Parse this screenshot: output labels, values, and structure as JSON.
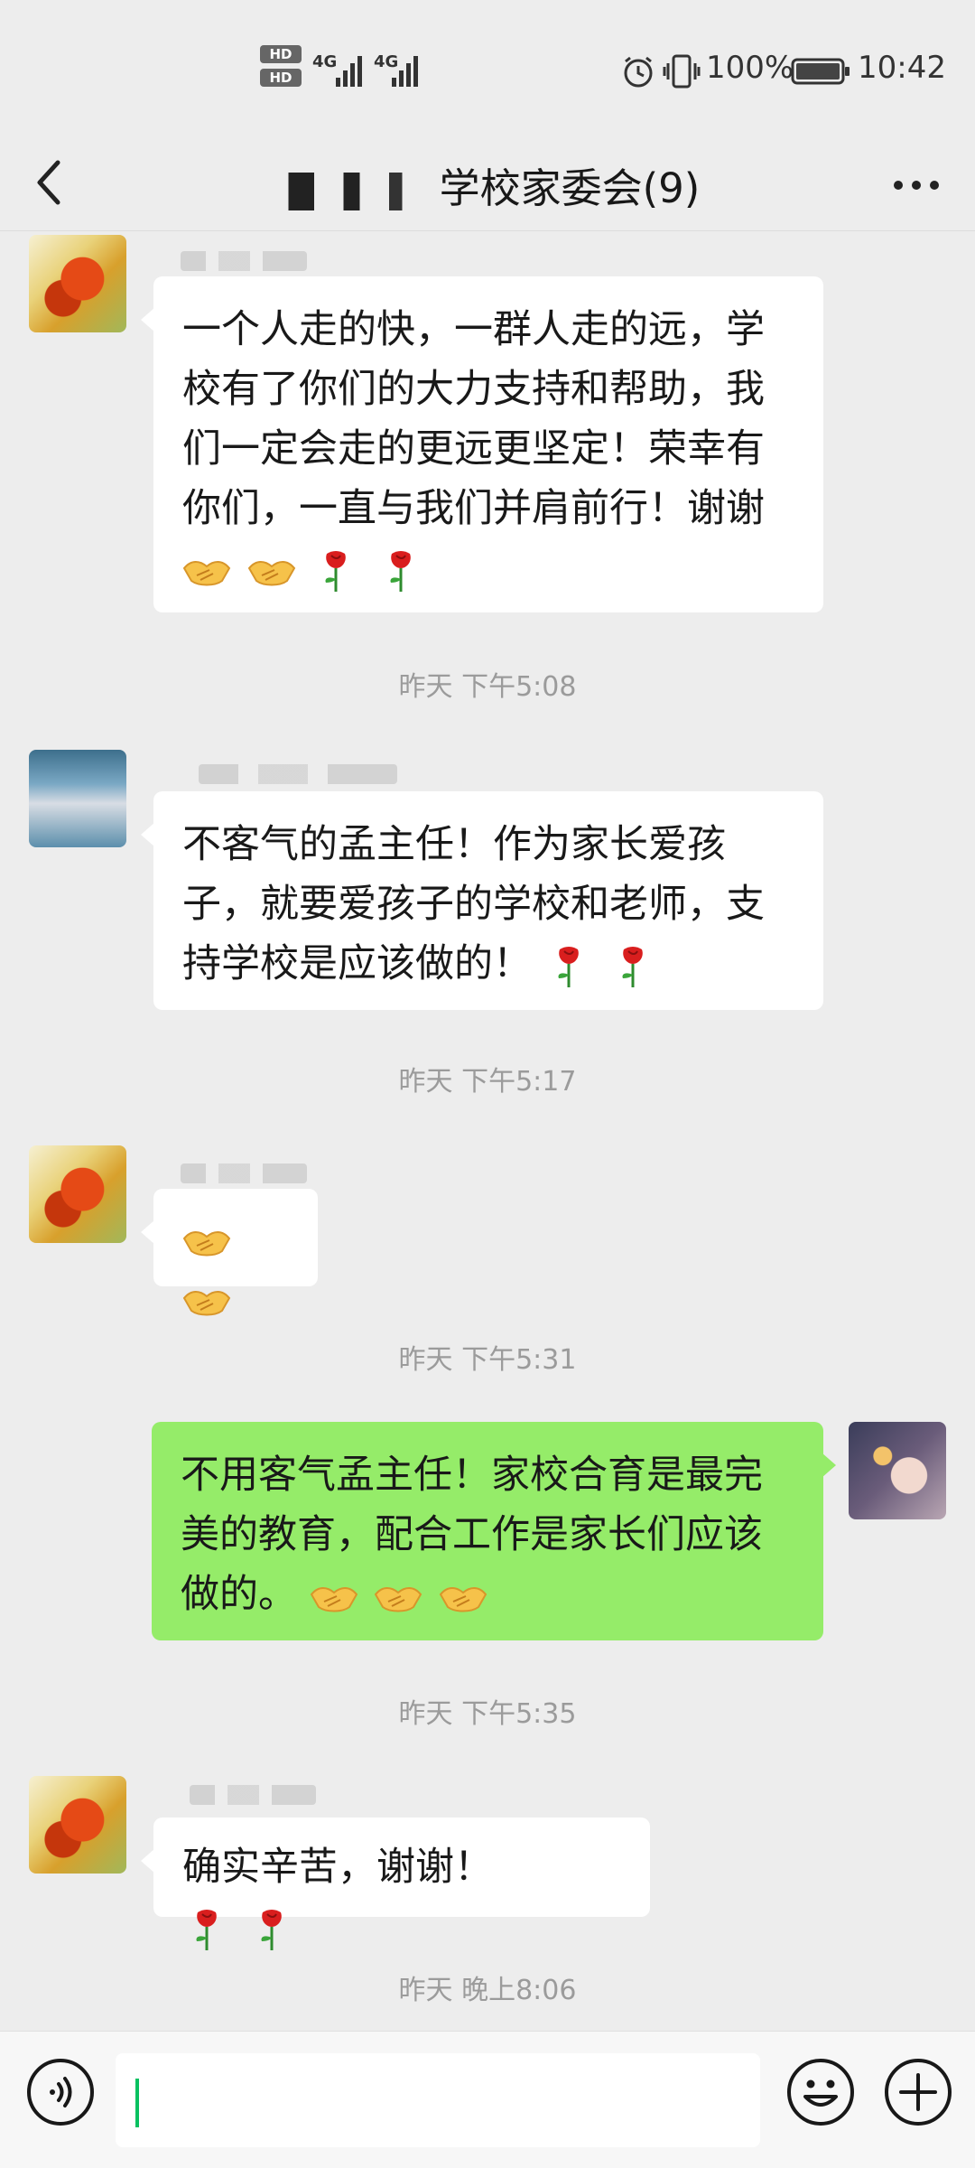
{
  "status_bar": {
    "battery_pct": "100%",
    "time": "10:42",
    "network_1": "4G",
    "network_2": "4G",
    "hd_1": "HD",
    "hd_2": "HD"
  },
  "header": {
    "title": "学校家委会(9)"
  },
  "messages": [
    {
      "side": "left",
      "text": "一个人走的快，一群人走的远，学校有了你们的大力支持和帮助，我们一定会走的更远更坚定！荣幸有你们，一直与我们并肩前行！谢谢",
      "emojis": [
        "handshake-emoji",
        "handshake-emoji",
        "rose-emoji",
        "rose-emoji"
      ]
    },
    {
      "timestamp": "昨天 下午5:08"
    },
    {
      "side": "left",
      "text": "不客气的孟主任！作为家长爱孩子，就要爱孩子的学校和老师，支持学校是应该做的！",
      "emojis": [
        "rose-emoji",
        "rose-emoji"
      ]
    },
    {
      "timestamp": "昨天 下午5:17"
    },
    {
      "side": "left",
      "text": "",
      "emojis": [
        "handshake-emoji",
        "handshake-emoji"
      ]
    },
    {
      "timestamp": "昨天 下午5:31"
    },
    {
      "side": "right",
      "text": "不用客气孟主任！家校合育是最完美的教育，配合工作是家长们应该做的。",
      "emojis": [
        "handshake-emoji",
        "handshake-emoji",
        "handshake-emoji"
      ]
    },
    {
      "timestamp": "昨天 下午5:35"
    },
    {
      "side": "left",
      "text": "确实辛苦，谢谢！",
      "emojis": [
        "rose-emoji",
        "rose-emoji"
      ]
    },
    {
      "timestamp": "昨天 晚上8:06"
    }
  ],
  "timestamps": [
    "昨天 下午5:08",
    "昨天 下午5:17",
    "昨天 下午5:31",
    "昨天 下午5:35",
    "昨天 晚上8:06"
  ],
  "input_bar": {
    "voice_icon": "voice-icon",
    "emoji_icon": "emoji-icon",
    "plus_icon": "plus-icon"
  },
  "colors": {
    "background": "#ededed",
    "self_bubble": "#95ec69",
    "other_bubble": "#ffffff",
    "caret": "#07c160"
  }
}
